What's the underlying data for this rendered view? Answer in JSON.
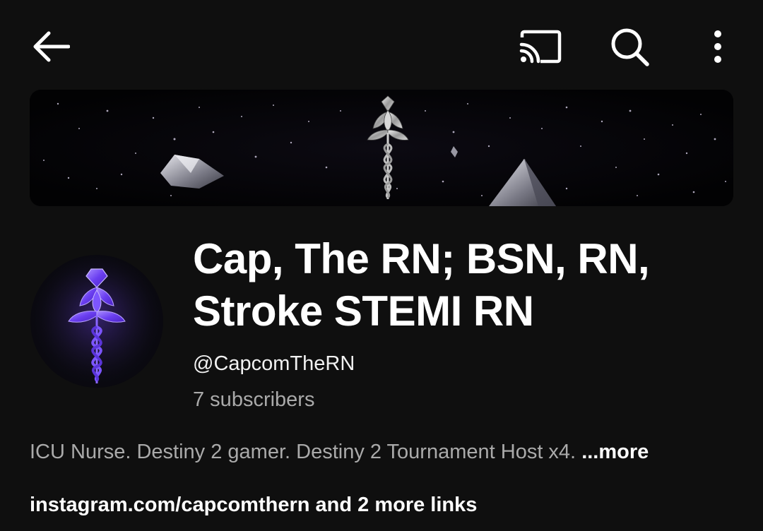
{
  "topbar": {
    "back_icon": "arrow-left-icon",
    "cast_icon": "cast-icon",
    "search_icon": "search-icon",
    "more_icon": "more-vert-icon"
  },
  "banner": {
    "image": "nurse-caduceus-lotus-space-banner"
  },
  "avatar": {
    "image": "purple-caduceus-lotus-logo"
  },
  "channel": {
    "title_line1": "Cap, The RN; BSN, RN,",
    "title_line2": "Stroke STEMI RN",
    "handle": "@CapcomTheRN",
    "subscribers": "7 subscribers"
  },
  "description": {
    "text": "ICU Nurse. Destiny 2 gamer. Destiny 2 Tournament Host x4.",
    "more_label": "...more"
  },
  "links": {
    "primary": "instagram.com/capcomthern",
    "extra": "and 2 more links"
  },
  "colors": {
    "background": "#0f0f0f",
    "text_primary": "#ffffff",
    "text_secondary": "#aaaaaa",
    "accent_purple": "#7b4dff"
  }
}
